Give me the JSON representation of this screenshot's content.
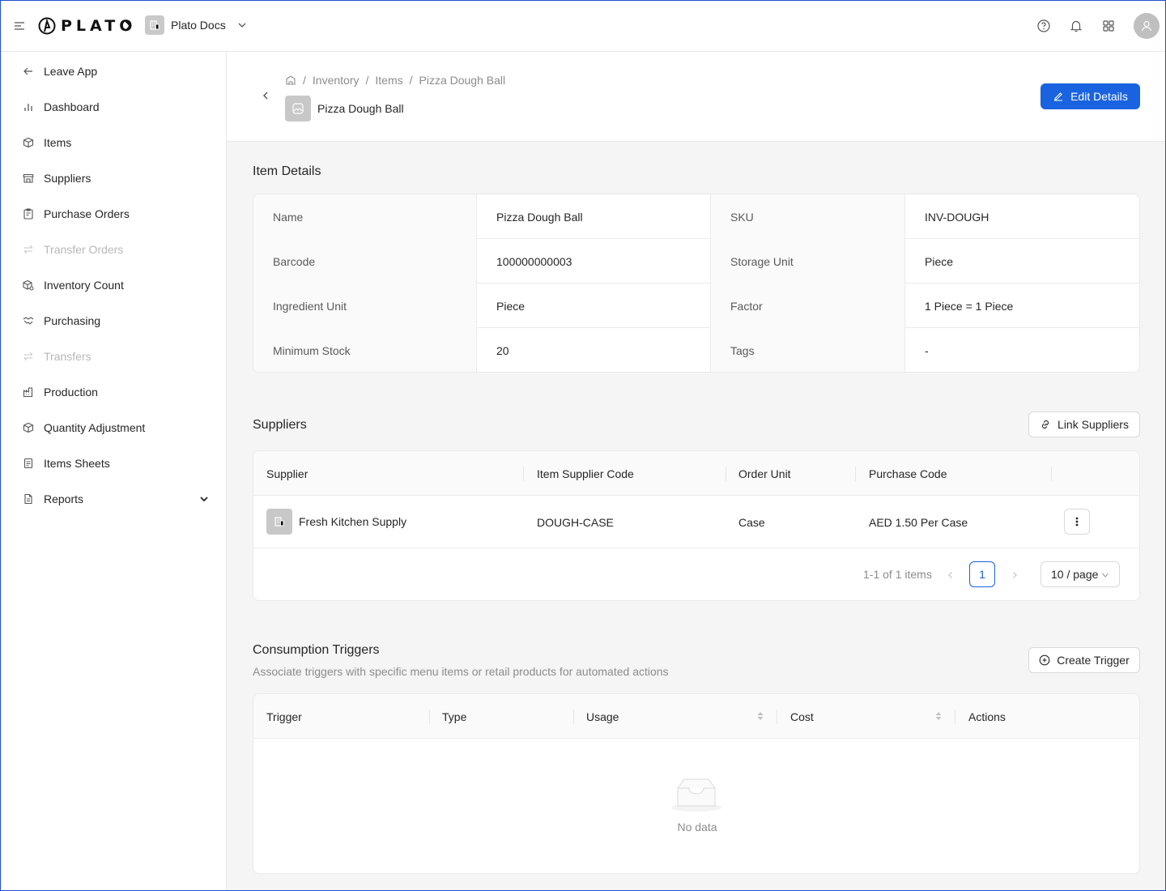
{
  "topbar": {
    "logo_text": "PLATO",
    "org_name": "Plato Docs"
  },
  "sidebar": {
    "items": [
      {
        "label": "Leave App",
        "icon": "arrow-left-icon",
        "disabled": false
      },
      {
        "label": "Dashboard",
        "icon": "bar-chart-icon",
        "disabled": false
      },
      {
        "label": "Items",
        "icon": "box-icon",
        "disabled": false
      },
      {
        "label": "Suppliers",
        "icon": "store-icon",
        "disabled": false
      },
      {
        "label": "Purchase Orders",
        "icon": "clipboard-icon",
        "disabled": false
      },
      {
        "label": "Transfer Orders",
        "icon": "transfer-icon",
        "disabled": true
      },
      {
        "label": "Inventory Count",
        "icon": "count-box-icon",
        "disabled": false
      },
      {
        "label": "Purchasing",
        "icon": "handshake-icon",
        "disabled": false
      },
      {
        "label": "Transfers",
        "icon": "swap-icon",
        "disabled": true
      },
      {
        "label": "Production",
        "icon": "factory-icon",
        "disabled": false
      },
      {
        "label": "Quantity Adjustment",
        "icon": "adjust-box-icon",
        "disabled": false
      },
      {
        "label": "Items Sheets",
        "icon": "sheet-icon",
        "disabled": false
      },
      {
        "label": "Reports",
        "icon": "report-icon",
        "disabled": false
      }
    ]
  },
  "header": {
    "breadcrumb": [
      "Inventory",
      "Items",
      "Pizza Dough Ball"
    ],
    "title": "Pizza Dough Ball",
    "edit_label": "Edit Details"
  },
  "details": {
    "title": "Item Details",
    "rows": [
      [
        {
          "label": "Name",
          "value": "Pizza Dough Ball"
        },
        {
          "label": "SKU",
          "value": "INV-DOUGH"
        }
      ],
      [
        {
          "label": "Barcode",
          "value": "100000000003"
        },
        {
          "label": "Storage Unit",
          "value": "Piece"
        }
      ],
      [
        {
          "label": "Ingredient Unit",
          "value": "Piece"
        },
        {
          "label": "Factor",
          "value": "1 Piece = 1 Piece"
        }
      ],
      [
        {
          "label": "Minimum Stock",
          "value": "20"
        },
        {
          "label": "Tags",
          "value": "-"
        }
      ]
    ]
  },
  "suppliers": {
    "title": "Suppliers",
    "link_label": "Link Suppliers",
    "columns": [
      "Supplier",
      "Item Supplier Code",
      "Order Unit",
      "Purchase Code"
    ],
    "rows": [
      {
        "supplier": "Fresh Kitchen Supply",
        "code": "DOUGH-CASE",
        "unit": "Case",
        "purchase": "AED 1.50 Per Case"
      }
    ],
    "pagination": {
      "total_text": "1-1 of 1 items",
      "current_page": "1",
      "page_size": "10 / page"
    }
  },
  "triggers": {
    "title": "Consumption Triggers",
    "subtitle": "Associate triggers with specific menu items or retail products for automated actions",
    "create_label": "Create Trigger",
    "columns": [
      "Trigger",
      "Type",
      "Usage",
      "Cost",
      "Actions"
    ],
    "empty_text": "No data"
  },
  "colors": {
    "primary": "#1a63e0",
    "disabled_text": "#b8b8b8"
  }
}
